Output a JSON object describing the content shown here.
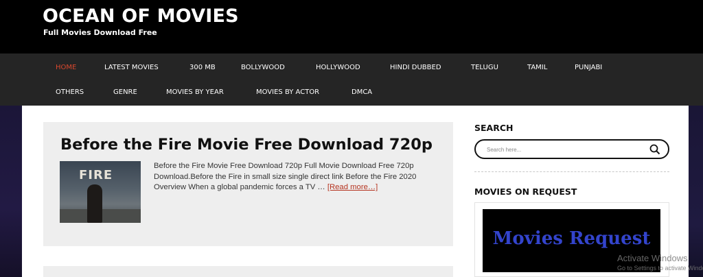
{
  "header": {
    "title": "OCEAN OF MOVIES",
    "tagline": "Full Movies Download Free"
  },
  "nav": {
    "items": [
      {
        "label": "HOME",
        "active": true
      },
      {
        "label": "LATEST MOVIES"
      },
      {
        "label": "300 MB"
      },
      {
        "label": "BOLLYWOOD"
      },
      {
        "label": "HOLLYWOOD"
      },
      {
        "label": "HINDI DUBBED"
      },
      {
        "label": "TELUGU"
      },
      {
        "label": "TAMIL"
      },
      {
        "label": "PUNJABI"
      },
      {
        "label": "OTHERS"
      },
      {
        "label": "GENRE"
      },
      {
        "label": "MOVIES BY YEAR"
      },
      {
        "label": "MOVIES BY ACTOR"
      },
      {
        "label": "DMCA"
      }
    ]
  },
  "post": {
    "title": "Before the Fire Movie Free Download 720p",
    "thumbnail_text": "FIRE",
    "excerpt": "Before the Fire Movie Free Download 720p Full Movie Download Free 720p Download.Before the Fire in small size single direct link Before the Fire 2020 Overview When a global pandemic forces a TV …",
    "read_more": "[Read more…]"
  },
  "sidebar": {
    "search_title": "SEARCH",
    "search_placeholder": "Search here...",
    "search_icon": "magnifier-icon",
    "requests_title": "MOVIES ON REQUEST",
    "requests_banner": "Movies Request"
  },
  "watermark": {
    "title": "Activate Windows",
    "subtitle": "Go to Settings to activate Windows."
  },
  "colors": {
    "nav_active": "#d8482e",
    "nav_bg": "#252525",
    "read_more": "#b5331f",
    "banner_text": "#3344cc"
  }
}
